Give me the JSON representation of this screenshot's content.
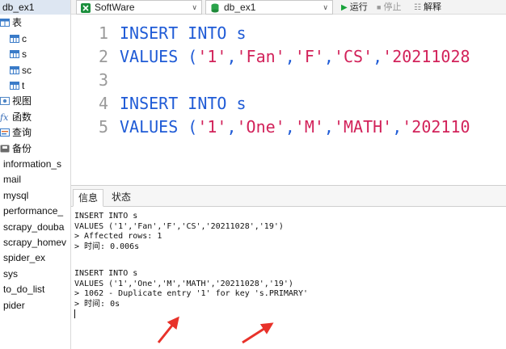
{
  "sidebar": {
    "items": [
      {
        "label": "db_ex1",
        "icon": "database-icon",
        "selected": true
      },
      {
        "label": "表",
        "icon": "table-folder-icon"
      },
      {
        "label": "c",
        "icon": "table-icon"
      },
      {
        "label": "s",
        "icon": "table-icon"
      },
      {
        "label": "sc",
        "icon": "table-icon"
      },
      {
        "label": "t",
        "icon": "table-icon"
      },
      {
        "label": "视图",
        "icon": "view-icon"
      },
      {
        "label": "函数",
        "icon": "function-icon"
      },
      {
        "label": "查询",
        "icon": "query-icon"
      },
      {
        "label": "备份",
        "icon": "backup-icon"
      },
      {
        "label": "information_s",
        "icon": ""
      },
      {
        "label": "mail",
        "icon": ""
      },
      {
        "label": "mysql",
        "icon": ""
      },
      {
        "label": "performance_",
        "icon": ""
      },
      {
        "label": "scrapy_douba",
        "icon": ""
      },
      {
        "label": "scrapy_homev",
        "icon": ""
      },
      {
        "label": "spider_ex",
        "icon": ""
      },
      {
        "label": "sys",
        "icon": ""
      },
      {
        "label": "to_do_list",
        "icon": ""
      },
      {
        "label": "pider",
        "icon": ""
      }
    ]
  },
  "toolbar": {
    "connection": "SoftWare",
    "database": "db_ex1",
    "run_label": "运行",
    "run_icon": "play-icon",
    "stop_label": "停止",
    "stop_icon": "stop-icon",
    "explain_label": "解释",
    "explain_icon": "explain-icon"
  },
  "editor": {
    "lines": [
      {
        "num": "1",
        "tokens": [
          {
            "t": "kw",
            "v": "INSERT INTO"
          },
          {
            "t": "plain",
            "v": " s"
          }
        ]
      },
      {
        "num": "2",
        "tokens": [
          {
            "t": "kw",
            "v": "VALUES"
          },
          {
            "t": "plain",
            "v": " ("
          },
          {
            "t": "str",
            "v": "'1'"
          },
          {
            "t": "plain",
            "v": ","
          },
          {
            "t": "str",
            "v": "'Fan'"
          },
          {
            "t": "plain",
            "v": ","
          },
          {
            "t": "str",
            "v": "'F'"
          },
          {
            "t": "plain",
            "v": ","
          },
          {
            "t": "str",
            "v": "'CS'"
          },
          {
            "t": "plain",
            "v": ","
          },
          {
            "t": "str",
            "v": "'20211028"
          }
        ]
      },
      {
        "num": "3",
        "tokens": []
      },
      {
        "num": "4",
        "tokens": [
          {
            "t": "kw",
            "v": "INSERT INTO"
          },
          {
            "t": "plain",
            "v": " s"
          }
        ]
      },
      {
        "num": "5",
        "tokens": [
          {
            "t": "kw",
            "v": "VALUES"
          },
          {
            "t": "plain",
            "v": " ("
          },
          {
            "t": "str",
            "v": "'1'"
          },
          {
            "t": "plain",
            "v": ","
          },
          {
            "t": "str",
            "v": "'One'"
          },
          {
            "t": "plain",
            "v": ","
          },
          {
            "t": "str",
            "v": "'M'"
          },
          {
            "t": "plain",
            "v": ","
          },
          {
            "t": "str",
            "v": "'MATH'"
          },
          {
            "t": "plain",
            "v": ","
          },
          {
            "t": "str",
            "v": "'202110"
          }
        ]
      }
    ]
  },
  "results": {
    "tabs": [
      {
        "label": "信息",
        "active": true
      },
      {
        "label": "状态",
        "active": false
      }
    ],
    "log": [
      "INSERT INTO s",
      "VALUES ('1','Fan','F','CS','20211028','19')",
      "> Affected rows: 1",
      "> 时间: 0.006s",
      "",
      "INSERT INTO s",
      "VALUES ('1','One','M','MATH','20211028','19')",
      "> 1062 - Duplicate entry '1' for key 's.PRIMARY'",
      "> 时间: 0s"
    ]
  },
  "colors": {
    "keyword": "#1f5bd6",
    "string": "#d2225a",
    "line_number": "#9a9a9a",
    "arrow": "#e8322a",
    "selection": "#dde6f2"
  }
}
